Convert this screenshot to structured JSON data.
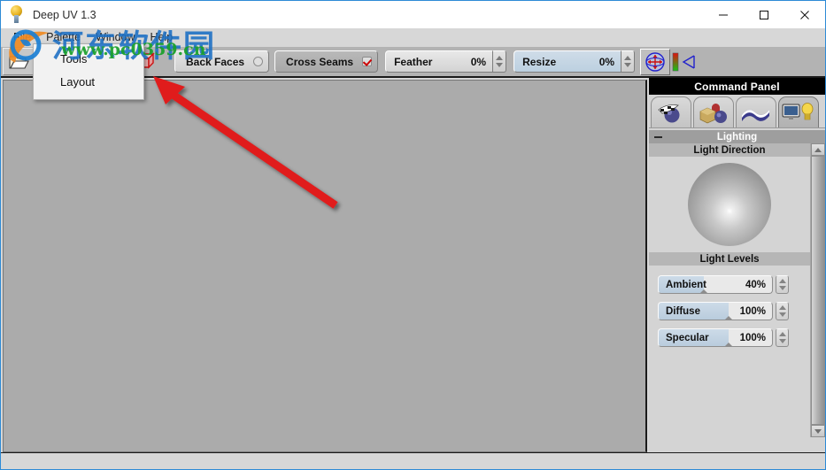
{
  "window": {
    "title": "Deep UV 1.3",
    "icon": "app-sphere-icon",
    "controls": {
      "minimize": "minimize-icon",
      "maximize": "maximize-icon",
      "close": "close-icon"
    }
  },
  "menubar": {
    "items": [
      {
        "label": "File"
      },
      {
        "label": "Palette"
      },
      {
        "label": "Window"
      },
      {
        "label": "Help"
      }
    ]
  },
  "dropdown": {
    "owner": "Palette",
    "items": [
      {
        "label": "Tools"
      },
      {
        "label": "Layout"
      }
    ]
  },
  "toolbar": {
    "open_icon": "open-folder-icon",
    "mode_icons": [
      {
        "name": "wireframe-cube-icon",
        "selected": true
      },
      {
        "name": "shaded-cube-icon",
        "selected": false
      },
      {
        "name": "unfold-cross-icon",
        "selected": false
      },
      {
        "name": "solid-cube-icon",
        "selected": false
      }
    ],
    "toggles": [
      {
        "label": "Back Faces",
        "checked": false,
        "active": false,
        "check_shape": "round"
      },
      {
        "label": "Cross Seams",
        "checked": true,
        "active": true,
        "check_shape": "square"
      }
    ],
    "spinners": [
      {
        "label": "Feather",
        "value": "0%",
        "filled": false
      },
      {
        "label": "Resize",
        "value": "0%",
        "filled": true
      }
    ],
    "right_icons": [
      {
        "name": "rotate-globe-icon",
        "selected": true
      },
      {
        "name": "color-ramp-icon",
        "selected": false
      },
      {
        "name": "cone-view-icon",
        "selected": false
      }
    ]
  },
  "command_panel": {
    "title": "Command Panel",
    "tabs": [
      {
        "name": "tab-checker-sphere",
        "active": false
      },
      {
        "name": "tab-objects",
        "active": false
      },
      {
        "name": "tab-ribbon",
        "active": false
      },
      {
        "name": "tab-display-lighting",
        "active": true
      }
    ],
    "section": {
      "title": "Lighting",
      "collapse_icon": "minus-icon",
      "light_direction": {
        "label": "Light Direction",
        "widget": "light-direction-sphere"
      },
      "light_levels": {
        "label": "Light Levels",
        "rows": [
          {
            "label": "Ambient",
            "value": "40%",
            "percent": 40
          },
          {
            "label": "Diffuse",
            "value": "100%",
            "percent": 62
          },
          {
            "label": "Specular",
            "value": "100%",
            "percent": 62
          }
        ]
      }
    },
    "scrollbar": {
      "up": "scroll-up-icon",
      "down": "scroll-down-icon"
    }
  },
  "annotation": {
    "arrow": "red-pointer-arrow",
    "color": "#e01b1b"
  },
  "watermark": {
    "site_cn": "河东软件园",
    "site_url": "www.pc0359.cn",
    "logo": "site-logo-icon",
    "color_cn": "#1b6fc4",
    "color_url": "#18a02a"
  },
  "statusbar": {
    "text": ""
  }
}
